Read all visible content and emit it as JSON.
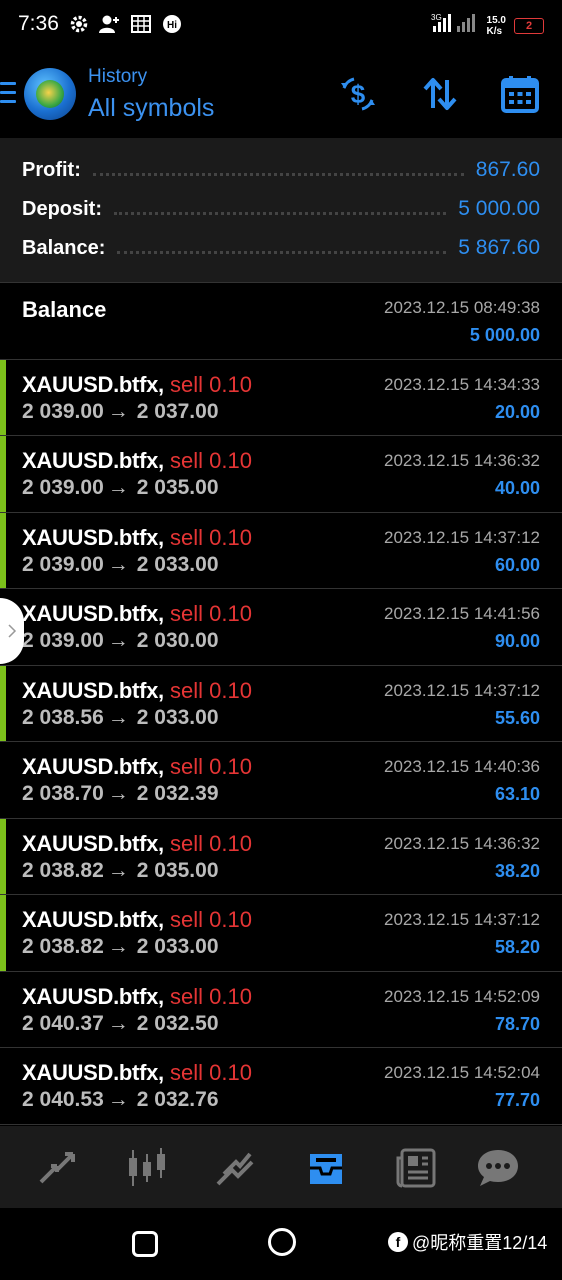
{
  "status_bar": {
    "time": "7:36",
    "net_speed_value": "15.0",
    "net_speed_unit": "K/s",
    "battery": "2",
    "signal_label": "3G"
  },
  "header": {
    "subtitle": "History",
    "title": "All symbols"
  },
  "summary": {
    "profit_label": "Profit:",
    "profit_value": "867.60",
    "deposit_label": "Deposit:",
    "deposit_value": "5 000.00",
    "balance_label": "Balance:",
    "balance_value": "5 867.60"
  },
  "balance_entry": {
    "title": "Balance",
    "datetime": "2023.12.15 08:49:38",
    "amount": "5 000.00"
  },
  "trades": [
    {
      "symbol": "XAUUSD.btfx,",
      "side": "sell 0.10",
      "open": "2 039.00",
      "close": "2 037.00",
      "datetime": "2023.12.15 14:34:33",
      "profit": "20.00",
      "accent": true
    },
    {
      "symbol": "XAUUSD.btfx,",
      "side": "sell 0.10",
      "open": "2 039.00",
      "close": "2 035.00",
      "datetime": "2023.12.15 14:36:32",
      "profit": "40.00",
      "accent": true
    },
    {
      "symbol": "XAUUSD.btfx,",
      "side": "sell 0.10",
      "open": "2 039.00",
      "close": "2 033.00",
      "datetime": "2023.12.15 14:37:12",
      "profit": "60.00",
      "accent": true
    },
    {
      "symbol": "XAUUSD.btfx,",
      "side": "sell 0.10",
      "open": "2 039.00",
      "close": "2 030.00",
      "datetime": "2023.12.15 14:41:56",
      "profit": "90.00",
      "accent": false
    },
    {
      "symbol": "XAUUSD.btfx,",
      "side": "sell 0.10",
      "open": "2 038.56",
      "close": "2 033.00",
      "datetime": "2023.12.15 14:37:12",
      "profit": "55.60",
      "accent": true
    },
    {
      "symbol": "XAUUSD.btfx,",
      "side": "sell 0.10",
      "open": "2 038.70",
      "close": "2 032.39",
      "datetime": "2023.12.15 14:40:36",
      "profit": "63.10",
      "accent": false
    },
    {
      "symbol": "XAUUSD.btfx,",
      "side": "sell 0.10",
      "open": "2 038.82",
      "close": "2 035.00",
      "datetime": "2023.12.15 14:36:32",
      "profit": "38.20",
      "accent": true
    },
    {
      "symbol": "XAUUSD.btfx,",
      "side": "sell 0.10",
      "open": "2 038.82",
      "close": "2 033.00",
      "datetime": "2023.12.15 14:37:12",
      "profit": "58.20",
      "accent": true
    },
    {
      "symbol": "XAUUSD.btfx,",
      "side": "sell 0.10",
      "open": "2 040.37",
      "close": "2 032.50",
      "datetime": "2023.12.15 14:52:09",
      "profit": "78.70",
      "accent": false
    },
    {
      "symbol": "XAUUSD.btfx,",
      "side": "sell 0.10",
      "open": "2 040.53",
      "close": "2 032.76",
      "datetime": "2023.12.15 14:52:04",
      "profit": "77.70",
      "accent": false
    }
  ],
  "arrow_glyph": "→",
  "tabs": [
    "quotes-icon",
    "chart-icon",
    "trade-icon",
    "history-icon",
    "news-icon",
    "messages-icon"
  ],
  "watermark": {
    "text": "@昵称重置12/14"
  },
  "colors": {
    "accent_blue": "#2e8ef0",
    "sell_red": "#e53535",
    "profit_bar_green": "#7cc11b"
  }
}
